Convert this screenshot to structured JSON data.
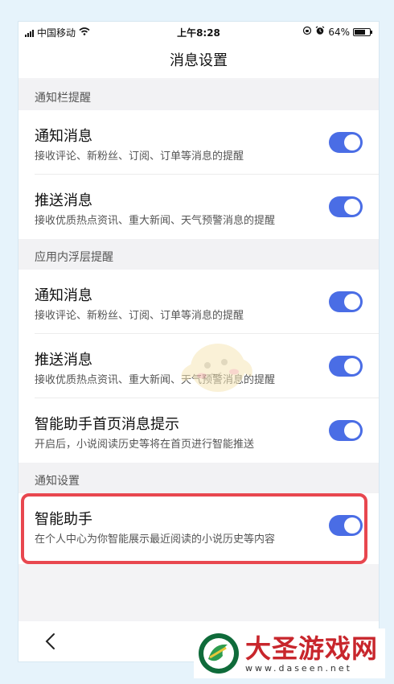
{
  "status_bar": {
    "carrier": "中国移动",
    "time": "上午8:28",
    "battery": "64%"
  },
  "header": {
    "title": "消息设置"
  },
  "sections": [
    {
      "title": "通知栏提醒",
      "items": [
        {
          "title": "通知消息",
          "subtitle": "接收评论、新粉丝、订阅、订单等消息的提醒",
          "enabled": true
        },
        {
          "title": "推送消息",
          "subtitle": "接收优质热点资讯、重大新闻、天气预警消息的提醒",
          "enabled": true
        }
      ]
    },
    {
      "title": "应用内浮层提醒",
      "items": [
        {
          "title": "通知消息",
          "subtitle": "接收评论、新粉丝、订阅、订单等消息的提醒",
          "enabled": true
        },
        {
          "title": "推送消息",
          "subtitle": "接收优质热点资讯、重大新闻、天气预警消息的提醒",
          "enabled": true
        },
        {
          "title": "智能助手首页消息提示",
          "subtitle": "开启后，小说阅读历史等将在首页进行智能推送",
          "enabled": true
        }
      ]
    },
    {
      "title": "通知设置",
      "items": [
        {
          "title": "智能助手",
          "subtitle": "在个人中心为你智能展示最近阅读的小说历史等内容",
          "enabled": true
        }
      ]
    }
  ],
  "colors": {
    "toggle_on": "#4a6de5",
    "highlight": "#e8474f",
    "watermark_red": "#c8262c"
  },
  "icons": {
    "back": "chevron-left-icon",
    "wifi": "wifi-icon",
    "alarm": "alarm-icon",
    "lock": "rotation-lock-icon"
  },
  "watermark": {
    "title": "大圣游戏网",
    "url": "www.daseen.net"
  }
}
